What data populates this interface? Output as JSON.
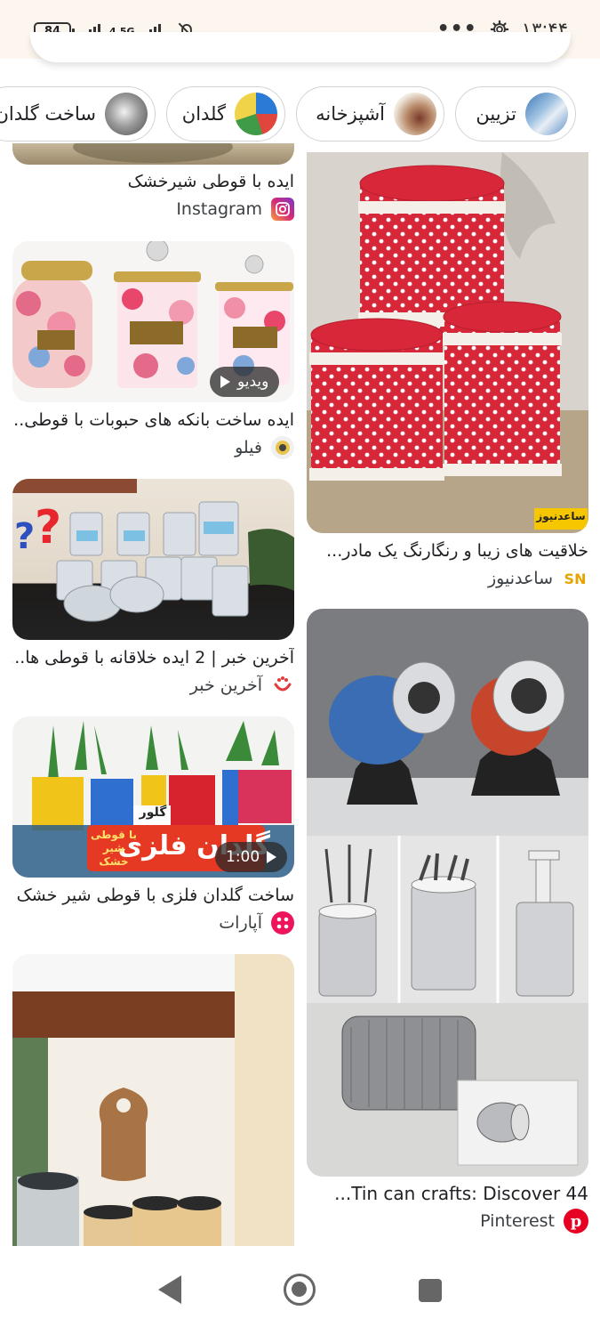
{
  "status_bar": {
    "time": "۱۳:۴۴",
    "battery": "84",
    "network": "4.5G",
    "icons": [
      "more-dots-icon",
      "settings-gear-icon",
      "bell-off-icon",
      "signal-icon",
      "battery-icon"
    ]
  },
  "chips": [
    {
      "label": "تزیین"
    },
    {
      "label": "آشپزخانه"
    },
    {
      "label": "گلدان"
    },
    {
      "label": "ساخت گلدان"
    }
  ],
  "left_column": [
    {
      "title": "ایده با قوطی شیرخشک",
      "source": "Instagram",
      "source_icon": "instagram-icon"
    },
    {
      "title": "ایده ساخت بانکه های حبوبات با قوطی...",
      "source": "فیلو",
      "source_icon": "filo-icon",
      "badge": "ویدیو"
    },
    {
      "title": "آخرین خبر | 2 ایده خلاقانه با قوطی ها...",
      "source": "آخرین خبر",
      "source_icon": "akharin-khabar-icon"
    },
    {
      "title": "ساخت گلدان فلزی با قوطی شیر خشک ...",
      "source": "آپارات",
      "source_icon": "aparat-icon",
      "badge": "1:00",
      "image_text": {
        "line1": "گلدان فلزی",
        "line2": "با قوطی",
        "line3": "شیر خشک",
        "line4": "گلور"
      }
    },
    {
      "title": "",
      "source": ""
    }
  ],
  "right_column": [
    {
      "title": "خلاقیت های زیبا و رنگارنگ یک مادر...",
      "source": "ساعدنیوز",
      "source_icon": "saednews-icon",
      "source_icon_text": "SN",
      "watermark": "ساعدنیوز"
    },
    {
      "title": "Tin can crafts: Discover 44...",
      "source": "Pinterest",
      "source_icon": "pinterest-icon"
    }
  ],
  "colors": {
    "status_bg": "#fdf6ef",
    "chip_border": "#d0d4d9",
    "pinterest_red": "#e60023",
    "instagram_pink": "#d62976",
    "polka_red": "#d9273a"
  }
}
